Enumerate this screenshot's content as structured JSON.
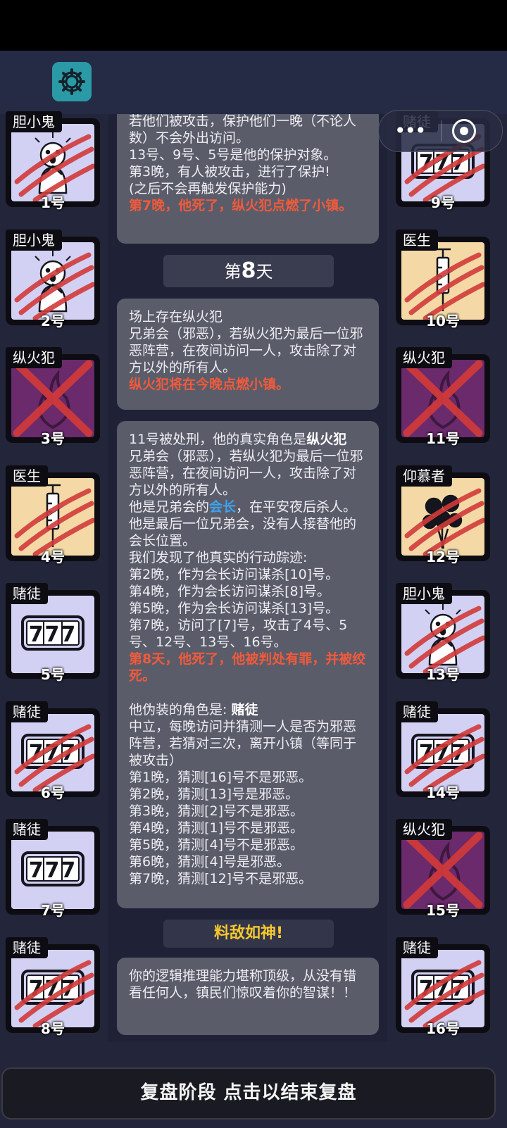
{
  "header": {
    "settings_icon": "gear-icon"
  },
  "capsule": {
    "menu_icon": "more-dots-icon",
    "close_icon": "target-icon"
  },
  "left_players": [
    {
      "role": "胆小鬼",
      "number": "1号",
      "art": "coward",
      "slashed": true
    },
    {
      "role": "胆小鬼",
      "number": "2号",
      "art": "coward",
      "slashed": true
    },
    {
      "role": "纵火犯",
      "number": "3号",
      "art": "arsonist",
      "crossed": true
    },
    {
      "role": "医生",
      "number": "4号",
      "art": "doctor",
      "slashed": true
    },
    {
      "role": "赌徒",
      "number": "5号",
      "art": "gambler",
      "slashed": false
    },
    {
      "role": "赌徒",
      "number": "6号",
      "art": "gambler",
      "slashed": true
    },
    {
      "role": "赌徒",
      "number": "7号",
      "art": "gambler",
      "slashed": false
    },
    {
      "role": "赌徒",
      "number": "8号",
      "art": "gambler",
      "slashed": true
    }
  ],
  "right_players": [
    {
      "role": "赌徒",
      "number": "9号",
      "art": "gambler",
      "slashed": true
    },
    {
      "role": "医生",
      "number": "10号",
      "art": "doctor",
      "slashed": true
    },
    {
      "role": "纵火犯",
      "number": "11号",
      "art": "arsonist",
      "crossed": true
    },
    {
      "role": "仰慕者",
      "number": "12号",
      "art": "admirer",
      "slashed": true
    },
    {
      "role": "胆小鬼",
      "number": "13号",
      "art": "coward",
      "slashed": true
    },
    {
      "role": "赌徒",
      "number": "14号",
      "art": "gambler",
      "slashed": true
    },
    {
      "role": "纵火犯",
      "number": "15号",
      "art": "arsonist",
      "crossed": true
    },
    {
      "role": "赌徒",
      "number": "16号",
      "art": "gambler",
      "slashed": true
    }
  ],
  "log": {
    "msg1": {
      "lines": [
        "若他们被攻击，保护他们一晚（不论人数）不会外出访问。",
        "13号、9号、5号是他的保护对象。",
        "第3晚，有人被攻击，进行了保护!",
        "(之后不会再触发保护能力)"
      ],
      "red": "第7晚，他死了，纵火犯点燃了小镇。"
    },
    "day_prefix": "第",
    "day_number": "8",
    "day_suffix": "天",
    "msg2": {
      "lines": [
        "场上存在纵火犯",
        "兄弟会（邪恶），若纵火犯为最后一位邪恶阵营，在夜间访问一人，攻击除了对方以外的所有人。"
      ],
      "red": "纵火犯将在今晚点燃小镇。"
    },
    "msg3": {
      "intro": "11号被处刑，他的真实角色是",
      "intro_role": "纵火犯",
      "line2": "兄弟会（邪恶），若纵火犯为最后一位邪恶阵营，在夜间访问一人，攻击除了对方以外的所有人。",
      "leader_pre": "他是兄弟会的",
      "leader_word": "会长",
      "leader_post": "，在平安夜后杀人。他是最后一位兄弟会，没有人接替他的会长位置。",
      "track_lines": [
        "我们发现了他真实的行动踪迹:",
        "第2晚，作为会长访问谋杀[10]号。",
        "第4晚，作为会长访问谋杀[8]号。",
        "第5晚，作为会长访问谋杀[13]号。",
        "第7晚，访问了[7]号，攻击了4号、5号、12号、13号、16号。"
      ],
      "death": "第8天，他死了，他被判处有罪，并被绞死。",
      "disguise_pre": "他伪装的角色是: ",
      "disguise_role": "赌徒",
      "disguise_desc": "中立，每晚访问并猜测一人是否为邪恶阵营，若猜对三次，离开小镇（等同于被攻击）",
      "guess_lines": [
        "第1晚，猜测[16]号不是邪恶。",
        "第2晚，猜测[13]号是邪恶。",
        "第3晚，猜测[2]号不是邪恶。",
        "第4晚，猜测[1]号不是邪恶。",
        "第5晚，猜测[4]号不是邪恶。",
        "第6晚，猜测[4]号是邪恶。",
        "第7晚，猜测[12]号不是邪恶。"
      ]
    },
    "praise_title": "料敌如神!",
    "praise_text": "你的逻辑推理能力堪称顶级，从没有错看任何人，镇民们惊叹着你的智谋！！"
  },
  "footer": {
    "label": "复盘阶段 点击以结束复盘"
  },
  "colors": {
    "card_lavender": "#d2d1f4",
    "card_peach": "#f4d9a6",
    "card_purple": "#6a2a6c",
    "slash": "#d23a3a",
    "death_text": "#f05a3c",
    "leader_text": "#3ea2ef",
    "praise_title": "#f4c82d"
  }
}
